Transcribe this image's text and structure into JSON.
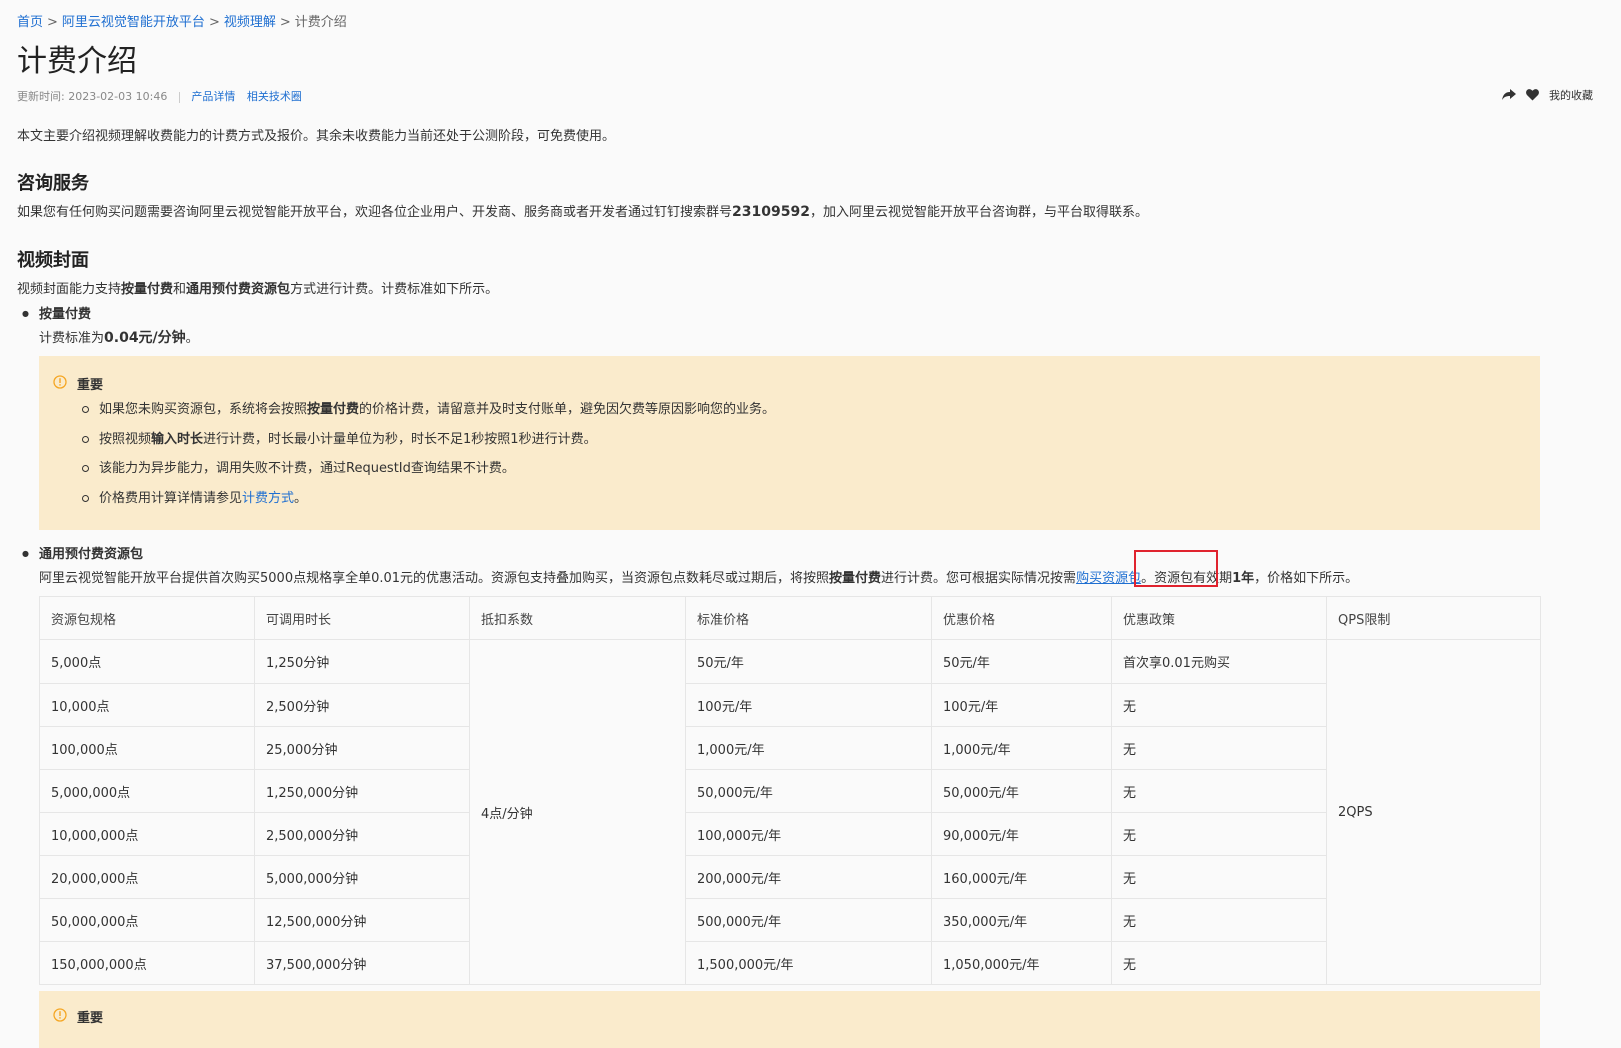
{
  "breadcrumb": {
    "items": [
      "首页",
      "阿里云视觉智能开放平台",
      "视频理解"
    ],
    "current": "计费介绍",
    "separator": ">"
  },
  "page_title": "计费介绍",
  "meta": {
    "updated_label": "更新时间:",
    "updated_time": "2023-02-03 10:46",
    "link_product": "产品详情",
    "link_tech": "相关技术圈"
  },
  "actions": {
    "favorites_label": "我的收藏"
  },
  "intro": "本文主要介绍视频理解收费能力的计费方式及报价。其余未收费能力当前还处于公测阶段，可免费使用。",
  "consult": {
    "heading": "咨询服务",
    "text_before": "如果您有任何购买问题需要咨询阿里云视觉智能开放平台，欢迎各位企业用户、开发商、服务商或者开发者通过钉钉搜索群号",
    "group_number": "23109592",
    "text_after": "，加入阿里云视觉智能开放平台咨询群，与平台取得联系。"
  },
  "cover": {
    "heading": "视频封面",
    "text_1": "视频封面能力支持",
    "bold_1": "按量付费",
    "text_2": "和",
    "bold_2": "通用预付费资源包",
    "text_3": "方式进行计费。计费标准如下所示。"
  },
  "pay_as_you_go": {
    "label": "按量付费",
    "standard_prefix": "计费标准为",
    "standard_value": "0.04元/分钟",
    "standard_suffix": "。"
  },
  "note": {
    "icon": "warning-circle-icon",
    "title": "重要",
    "item1_a": "如果您未购买资源包，系统将会按照",
    "item1_bold": "按量付费",
    "item1_b": "的价格计费，请留意并及时支付账单，避免因欠费等原因影响您的业务。",
    "item2_a": "按照视频",
    "item2_bold": "输入时长",
    "item2_b": "进行计费，时长最小计量单位为秒，时长不足1秒按照1秒进行计费。",
    "item3": "该能力为异步能力，调用失败不计费，通过RequestId查询结果不计费。",
    "item4_a": "价格费用计算详情请参见",
    "item4_link": "计费方式",
    "item4_b": "。"
  },
  "prepaid": {
    "label": "通用预付费资源包",
    "text_1": "阿里云视觉智能开放平台提供首次购买5000点规格享全单0.01元的优惠活动。资源包支持叠加购买，当资源包点数耗尽或过期后，将按照",
    "bold_1": "按量付费",
    "text_2": "进行计费。您可根据实际情况按需",
    "link": "购买资源包",
    "text_3": "。资源包有效期",
    "bold_2": "1年",
    "text_4": "，价格如下所示。"
  },
  "table": {
    "headers": [
      "资源包规格",
      "可调用时长",
      "抵扣系数",
      "标准价格",
      "优惠价格",
      "优惠政策",
      "QPS限制"
    ],
    "deduction": "4点/分钟",
    "qps": "2QPS",
    "rows": [
      [
        "5,000点",
        "1,250分钟",
        "50元/年",
        "50元/年",
        "首次享0.01元购买"
      ],
      [
        "10,000点",
        "2,500分钟",
        "100元/年",
        "100元/年",
        "无"
      ],
      [
        "100,000点",
        "25,000分钟",
        "1,000元/年",
        "1,000元/年",
        "无"
      ],
      [
        "5,000,000点",
        "1,250,000分钟",
        "50,000元/年",
        "50,000元/年",
        "无"
      ],
      [
        "10,000,000点",
        "2,500,000分钟",
        "100,000元/年",
        "90,000元/年",
        "无"
      ],
      [
        "20,000,000点",
        "5,000,000分钟",
        "200,000元/年",
        "160,000元/年",
        "无"
      ],
      [
        "50,000,000点",
        "12,500,000分钟",
        "500,000元/年",
        "350,000元/年",
        "无"
      ],
      [
        "150,000,000点",
        "37,500,000分钟",
        "1,500,000元/年",
        "1,050,000元/年",
        "无"
      ]
    ]
  },
  "note2": {
    "title": "重要"
  },
  "colors": {
    "link": "#1f6fd1",
    "note_bg": "#faebcc",
    "warning": "#f5a623",
    "highlight": "#e0232e"
  }
}
